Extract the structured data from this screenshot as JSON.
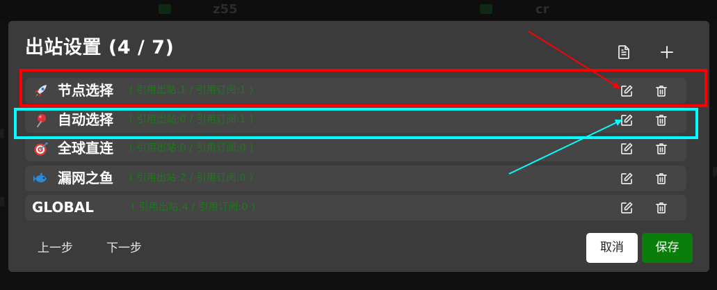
{
  "background": {
    "labels": [
      "z55",
      "cr"
    ]
  },
  "dialog": {
    "title": "出站设置 (4 / 7)",
    "header_icons": [
      "document-icon",
      "plus-icon"
    ]
  },
  "outbounds": [
    {
      "icon": "rocket-icon",
      "name": "节点选择",
      "stats": "( 引用出站:1 / 引用订阅:1 )"
    },
    {
      "icon": "pushpin-icon",
      "name": "自动选择",
      "stats": "( 引用出站:0 / 引用订阅:1 )"
    },
    {
      "icon": "target-icon",
      "name": "全球直连",
      "stats": "( 引用出站:0 / 引用订阅:0 )"
    },
    {
      "icon": "fish-icon",
      "name": "漏网之鱼",
      "stats": "( 引用出站:2 / 引用订阅:0 )"
    },
    {
      "icon": "",
      "name": "GLOBAL",
      "stats": "( 引用出站:4 / 引用订阅:0 )"
    }
  ],
  "footer": {
    "prev": "上一步",
    "next": "下一步",
    "cancel": "取消",
    "save": "保存"
  },
  "colors": {
    "dialog_bg": "#3b3b3b",
    "row_bg": "#454545",
    "stats_text": "#1a7a1a",
    "save_button": "#0a7d0a",
    "annotation_red": "#ff0000",
    "annotation_cyan": "#00ffff"
  }
}
